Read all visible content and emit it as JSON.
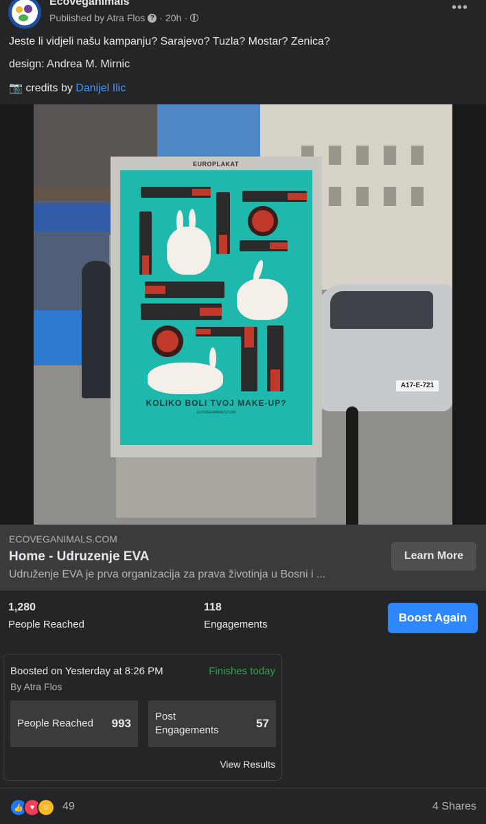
{
  "post": {
    "page_name": "Ecoveganimals",
    "published_by": "Published by Atra Flos",
    "time": "20h",
    "more": "•••",
    "line1": "Jeste li vidjeli našu kampanju? Sarajevo? Tuzla? Mostar? Zenica?",
    "line2": "design: Andrea M. Mirnic",
    "line3_prefix": "📷 credits by",
    "line3_link": "Danijel Ilic"
  },
  "photo": {
    "billboard_brand": "EUROPLAKAT",
    "poster_slogan": "KOLIKO BOLI TVOJ MAKE-UP?",
    "poster_url": "ECOVEGANIMALS.COM",
    "car_plate": "A17-E-721"
  },
  "link_card": {
    "domain": "ECOVEGANIMALS.COM",
    "title": "Home - Udruzenje EVA",
    "description": "Udruženje EVA je prva organizacija za prava životinja u Bosni i ...",
    "cta": "Learn More"
  },
  "stats": {
    "reached_value": "1,280",
    "reached_label": "People Reached",
    "engagements_value": "118",
    "engagements_label": "Engagements",
    "boost_again": "Boost Again"
  },
  "boost": {
    "boosted_on": "Boosted on Yesterday at 8:26 PM",
    "status": "Finishes today",
    "by": "By Atra Flos",
    "people_reached_label": "People Reached",
    "people_reached_value": "993",
    "post_engagements_label_1": "Post",
    "post_engagements_label_2": "Engagements",
    "post_engagements_value": "57",
    "view_results": "View Results"
  },
  "footer": {
    "reaction_count": "49",
    "shares": "4 Shares",
    "reaction_icons": [
      "like-icon",
      "love-icon",
      "care-icon"
    ]
  },
  "colors": {
    "background": "#242526",
    "card": "#3a3b3c",
    "accent_blue": "#2d88ff",
    "status_green": "#31a24c"
  }
}
